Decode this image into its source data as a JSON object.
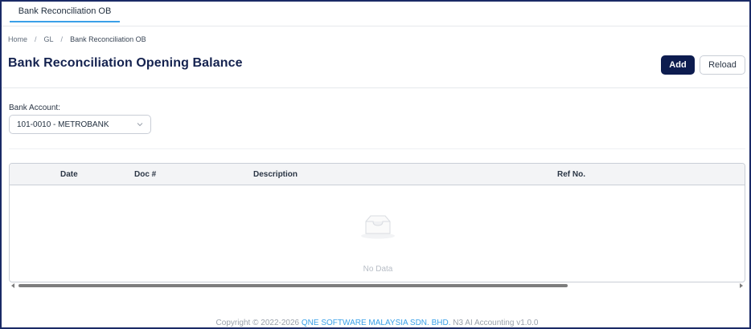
{
  "tabs": [
    {
      "label": "Bank Reconciliation OB",
      "active": true
    }
  ],
  "breadcrumb": [
    {
      "label": "Home"
    },
    {
      "label": "GL"
    },
    {
      "label": "Bank Reconciliation OB"
    }
  ],
  "breadcrumb_separator": "/",
  "page": {
    "title": "Bank Reconciliation Opening Balance"
  },
  "toolbar": {
    "add_label": "Add",
    "reload_label": "Reload"
  },
  "filters": {
    "bank_account_label": "Bank Account:",
    "bank_account_value": "101-0010 - METROBANK"
  },
  "table": {
    "columns": [
      "Date",
      "Doc #",
      "Description",
      "Ref No."
    ],
    "rows": [],
    "empty_text": "No Data"
  },
  "footer": {
    "prefix": "Copyright",
    "copyright_symbol": "©",
    "years": " 2022-2026 ",
    "company": "QNE SOFTWARE MALAYSIA SDN. BHD.",
    "suffix": " N3 AI Accounting v1.0.0"
  },
  "colors": {
    "primary": "#0d1c4f",
    "accent": "#3aa0e8",
    "title": "#14224f"
  },
  "icons": {
    "select_chevron": "chevron-down-icon",
    "empty_state": "empty-inbox-icon",
    "scroll_left": "caret-left-icon",
    "scroll_right": "caret-right-icon"
  }
}
